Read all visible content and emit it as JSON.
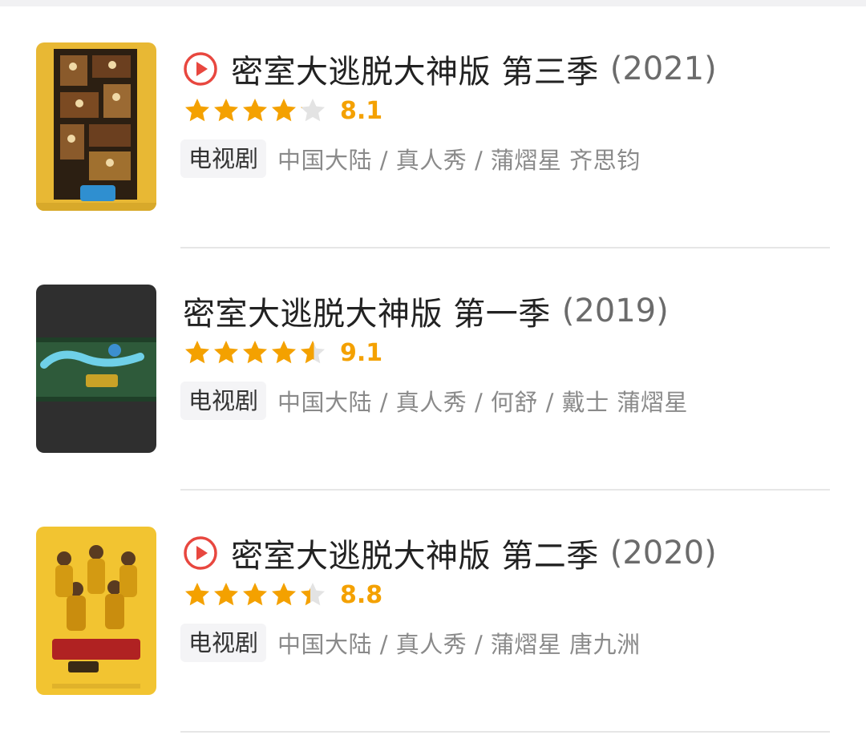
{
  "items": [
    {
      "title": "密室大逃脱大神版 第三季",
      "year": "(2021)",
      "has_play_icon": true,
      "rating": 8.1,
      "rating_text": "8.1",
      "tag": "电视剧",
      "info": "中国大陆 / 真人秀 / 蒲熠星 齐思钧",
      "poster_theme": "yellow-rooms"
    },
    {
      "title": "密室大逃脱大神版 第一季",
      "year": "(2019)",
      "has_play_icon": false,
      "rating": 9.1,
      "rating_text": "9.1",
      "tag": "电视剧",
      "info": "中国大陆 / 真人秀 / 何舒 / 戴士 蒲熠星",
      "poster_theme": "dark-green-logo"
    },
    {
      "title": "密室大逃脱大神版 第二季",
      "year": "(2020)",
      "has_play_icon": true,
      "rating": 8.8,
      "rating_text": "8.8",
      "tag": "电视剧",
      "info": "中国大陆 / 真人秀 / 蒲熠星 唐九洲",
      "poster_theme": "yellow-group"
    }
  ],
  "colors": {
    "star_filled": "#f4a100",
    "star_empty": "#e3e3e3",
    "play_icon": "#e8473f",
    "score": "#f4a100"
  }
}
